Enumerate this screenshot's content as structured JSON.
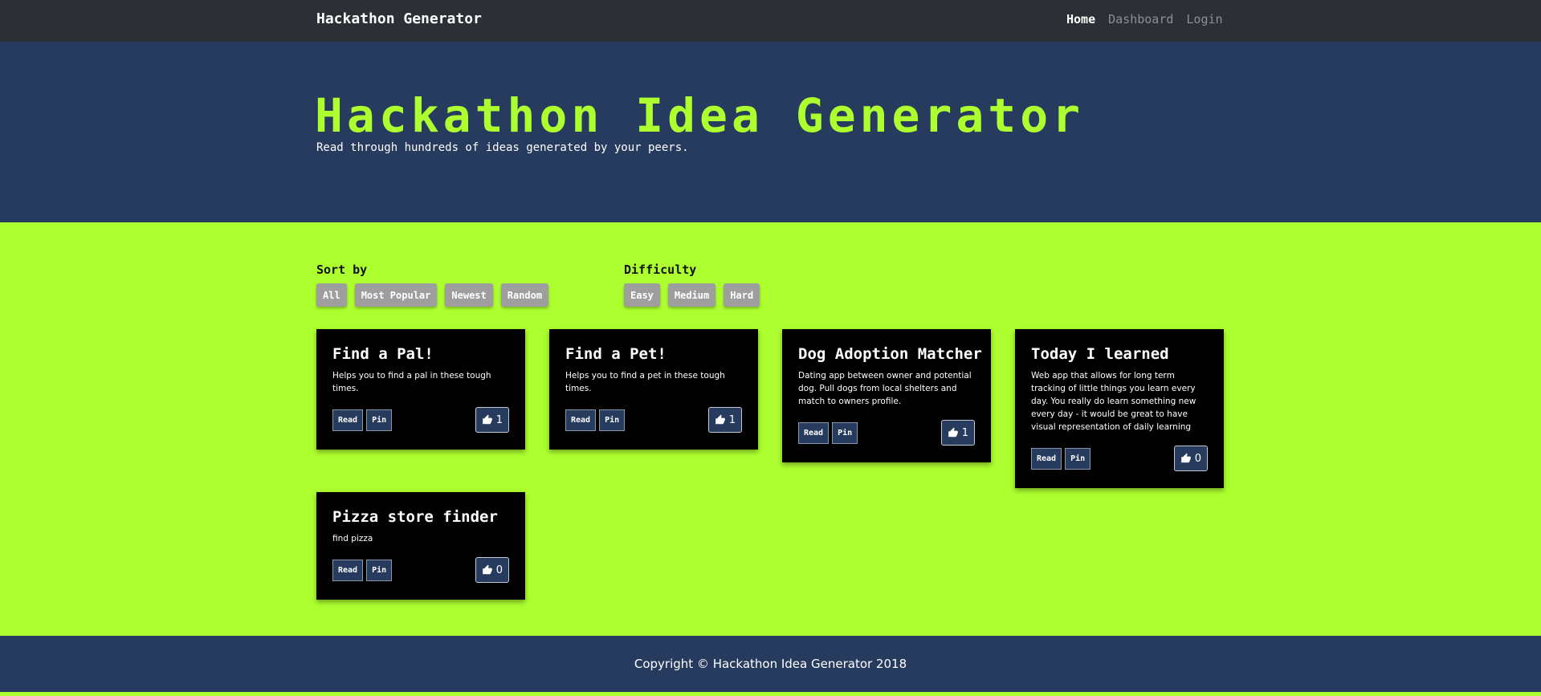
{
  "navbar": {
    "brand": "Hackathon Generator",
    "links": [
      {
        "label": "Home",
        "active": true
      },
      {
        "label": "Dashboard",
        "active": false
      },
      {
        "label": "Login",
        "active": false
      }
    ]
  },
  "hero": {
    "title": "Hackathon Idea Generator",
    "subtitle": "Read through hundreds of ideas generated by your peers."
  },
  "filters": {
    "sort": {
      "label": "Sort by",
      "options": [
        "All",
        "Most Popular",
        "Newest",
        "Random"
      ]
    },
    "difficulty": {
      "label": "Difficulty",
      "options": [
        "Easy",
        "Medium",
        "Hard"
      ]
    }
  },
  "ideas": [
    {
      "title": "Find a Pal!",
      "description": "Helps you to find a pal in these tough times.",
      "read_label": "Read",
      "pin_label": "Pin",
      "likes": "1"
    },
    {
      "title": "Find a Pet!",
      "description": "Helps you to find a pet in these tough times.",
      "read_label": "Read",
      "pin_label": "Pin",
      "likes": "1"
    },
    {
      "title": "Dog Adoption Matcher",
      "description": "Dating app between owner and potential dog. Pull dogs from local shelters and match to owners profile.",
      "read_label": "Read",
      "pin_label": "Pin",
      "likes": "1"
    },
    {
      "title": "Today I learned",
      "description": "Web app that allows for long term tracking of little things you learn every day. You really do learn something new every day - it would be great to have visual representation of daily learning",
      "read_label": "Read",
      "pin_label": "Pin",
      "likes": "0"
    },
    {
      "title": "Pizza store finder",
      "description": "find pizza",
      "read_label": "Read",
      "pin_label": "Pin",
      "likes": "0"
    }
  ],
  "footer": {
    "copyright": "Copyright © Hackathon Idea Generator 2018"
  },
  "colors": {
    "accent": "#adff2f",
    "navy": "#263b5e",
    "navbar": "#2c3036",
    "card": "#000000",
    "filter_button": "#9e9e9e"
  },
  "icons": {
    "like": "thumbs-up-icon"
  }
}
